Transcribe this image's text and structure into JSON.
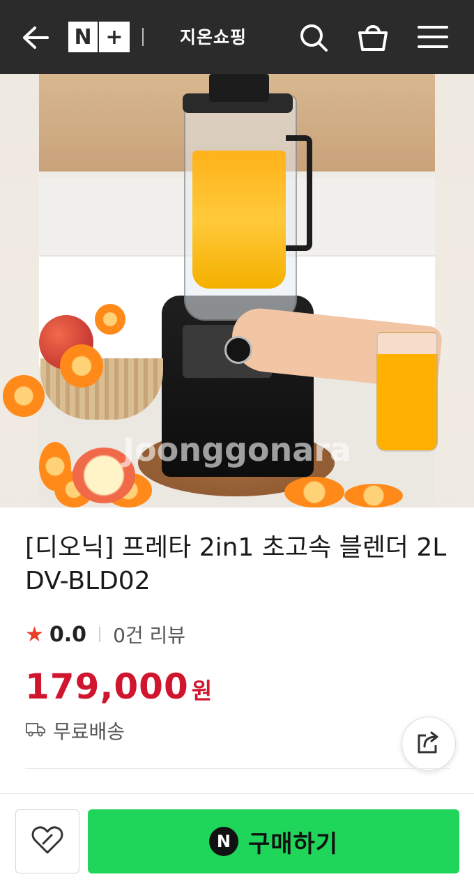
{
  "header": {
    "logo_left": "N",
    "logo_right": "+",
    "store_name": "지온쇼핑"
  },
  "hero": {
    "watermark": "Joonggonara"
  },
  "product": {
    "title": "[디오닉] 프레타 2in1 초고속 블렌더 2L DV-BLD02",
    "rating_star": "★",
    "rating": "0.0",
    "review_count": "0건 리뷰",
    "price": "179,000",
    "currency": "원",
    "shipping": "무료배송"
  },
  "bottom_bar": {
    "buy_badge": "N",
    "buy_label": "구매하기"
  },
  "colors": {
    "header_bg": "#2b2b2b",
    "price": "#d0152f",
    "buy_button": "#1fd65a",
    "star": "#ea3e2a"
  },
  "icons": [
    "back-arrow-icon",
    "search-icon",
    "shopping-bag-icon",
    "menu-icon",
    "truck-icon",
    "share-icon",
    "heart-link-icon"
  ]
}
